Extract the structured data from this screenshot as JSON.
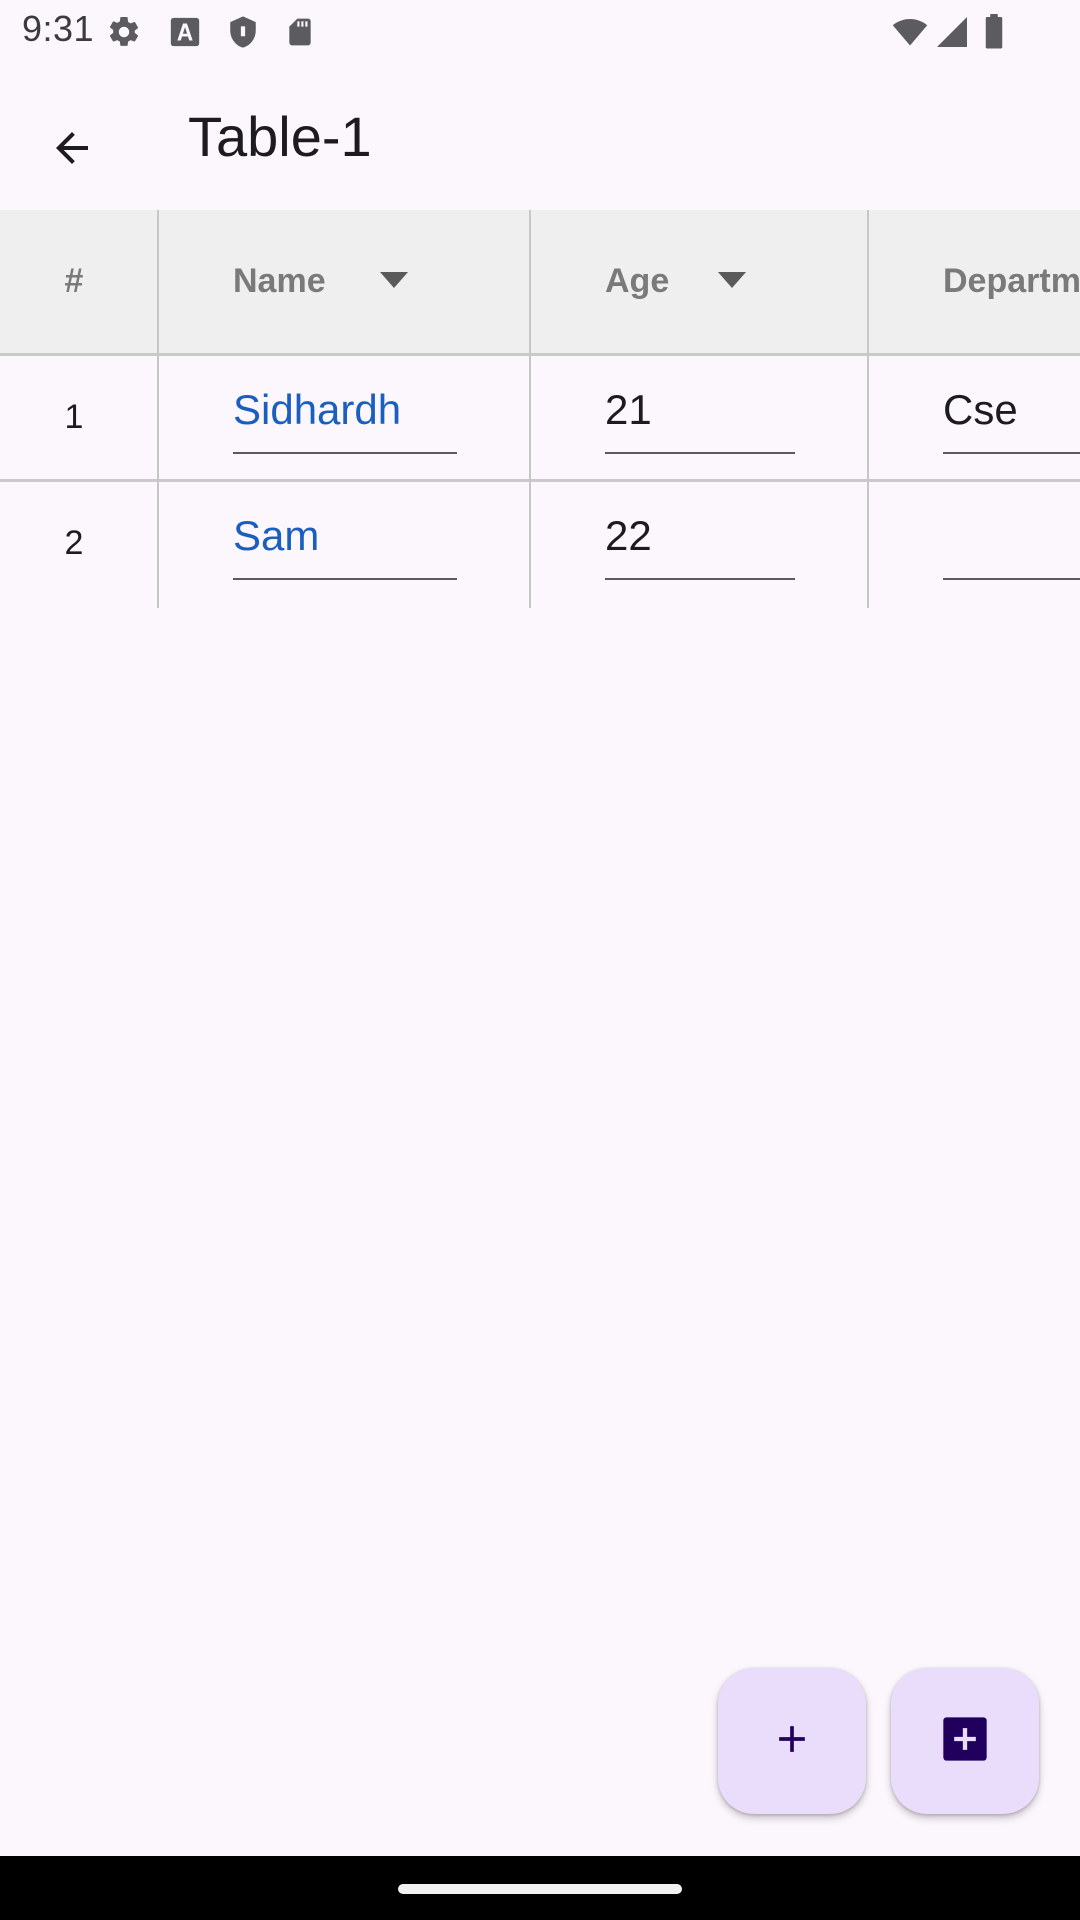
{
  "status_bar": {
    "time": "9:31",
    "left_icons": [
      "gear-icon",
      "font-a-icon",
      "shield-icon",
      "sd-card-icon"
    ],
    "right_icons": [
      "wifi-icon",
      "cell-signal-icon",
      "battery-icon"
    ]
  },
  "app_bar": {
    "title": "Table-1",
    "back_icon": "arrow-back-icon"
  },
  "table": {
    "columns": [
      {
        "label": "#",
        "sortable": false
      },
      {
        "label": "Name",
        "sortable": true
      },
      {
        "label": "Age",
        "sortable": true
      },
      {
        "label": "Departm",
        "sortable": false
      }
    ],
    "rows": [
      {
        "index": "1",
        "name": "Sidhardh",
        "age": "21",
        "department": "Cse"
      },
      {
        "index": "2",
        "name": "Sam",
        "age": "22",
        "department": ""
      }
    ]
  },
  "fabs": [
    {
      "name": "add-row-fab",
      "icon": "plus-icon"
    },
    {
      "name": "add-column-fab",
      "icon": "add-box-icon"
    }
  ],
  "colors": {
    "background": "#fcf7fd",
    "header_background": "#efefef",
    "link_text": "#1a5fc0",
    "fab_background": "#eaddfb",
    "fab_icon": "#21005d"
  }
}
